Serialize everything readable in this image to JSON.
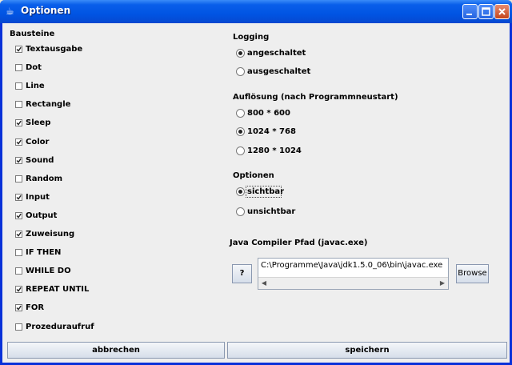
{
  "window": {
    "title": "Optionen"
  },
  "bausteine": {
    "heading": "Bausteine",
    "items": [
      {
        "label": "Textausgabe",
        "checked": true
      },
      {
        "label": "Dot",
        "checked": false
      },
      {
        "label": "Line",
        "checked": false
      },
      {
        "label": "Rectangle",
        "checked": false
      },
      {
        "label": "Sleep",
        "checked": true
      },
      {
        "label": "Color",
        "checked": true
      },
      {
        "label": "Sound",
        "checked": true
      },
      {
        "label": "Random",
        "checked": false
      },
      {
        "label": "Input",
        "checked": true
      },
      {
        "label": "Output",
        "checked": true
      },
      {
        "label": "Zuweisung",
        "checked": true
      },
      {
        "label": "IF THEN",
        "checked": false
      },
      {
        "label": "WHILE DO",
        "checked": false
      },
      {
        "label": "REPEAT UNTIL",
        "checked": true
      },
      {
        "label": "FOR",
        "checked": true
      },
      {
        "label": "Prozeduraufruf",
        "checked": false
      }
    ]
  },
  "logging": {
    "heading": "Logging",
    "options": [
      {
        "label": "angeschaltet",
        "selected": true
      },
      {
        "label": "ausgeschaltet",
        "selected": false
      }
    ]
  },
  "aufloesung": {
    "heading": "Auflösung (nach Programmneustart)",
    "options": [
      {
        "label": "800 * 600",
        "selected": false
      },
      {
        "label": "1024 * 768",
        "selected": true
      },
      {
        "label": "1280 * 1024",
        "selected": false
      }
    ]
  },
  "optionen": {
    "heading": "Optionen",
    "options": [
      {
        "label": "sichtbar",
        "selected": true
      },
      {
        "label": "unsichtbar",
        "selected": false
      }
    ]
  },
  "compiler": {
    "heading": "Java Compiler Pfad (javac.exe)",
    "help_label": "?",
    "path_value": "C:\\Programme\\Java\\jdk1.5.0_06\\bin\\javac.exe",
    "browse_label": "Browse"
  },
  "footer": {
    "cancel_label": "abbrechen",
    "save_label": "speichern"
  },
  "colors": {
    "titlebar": "#0054E3",
    "background": "#EEEEEE",
    "close_button": "#C4461C"
  }
}
